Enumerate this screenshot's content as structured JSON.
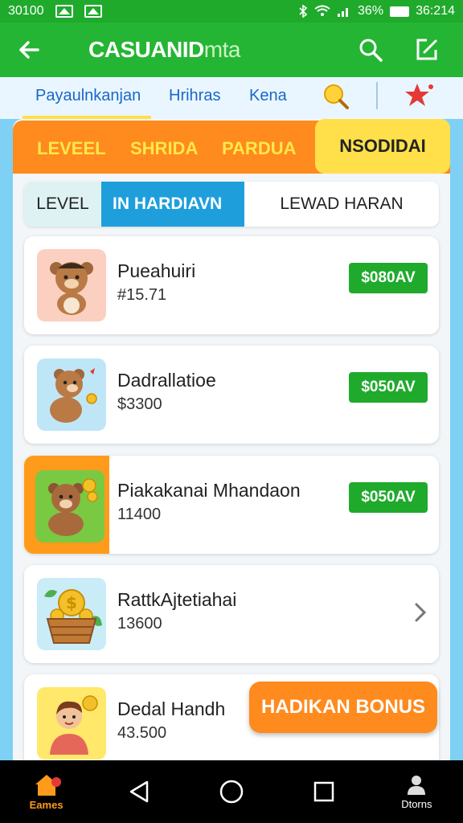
{
  "status_bar": {
    "time_left": "30100",
    "battery": "36%",
    "time_right": "36:214"
  },
  "app_bar": {
    "title_bold": "CASUANID",
    "title_light": "mta"
  },
  "sub_nav": {
    "items": [
      "Payaulnkanjan",
      "Hrihras",
      "Kena"
    ]
  },
  "categories": {
    "items": [
      "LEVEEL",
      "SHRIDA",
      "PARDUA"
    ],
    "active": "NSODIDAI"
  },
  "segments": {
    "items": [
      "LEVEL",
      "IN HARDIAVN",
      "LEWAD HARAN"
    ]
  },
  "cards": [
    {
      "name": "Pueahuiri",
      "amount": "#15.71",
      "action": "$080AV"
    },
    {
      "name": "Dadrallatioe",
      "amount": "$3300",
      "action": "$050AV"
    },
    {
      "name": "Piakakanai Mhandaon",
      "amount": "11400",
      "action": "$050AV"
    },
    {
      "name": "RattkAjtetiahai",
      "amount": "13600"
    },
    {
      "name": "Dedal Handh",
      "amount": "43.500"
    }
  ],
  "bonus_button": {
    "label": "HADIKAN BONUS"
  },
  "nav": {
    "home_label": "Eames",
    "profile_label": "Dtorns"
  },
  "colors": {
    "primary_green": "#25b534",
    "accent_orange": "#ff8a1e",
    "accent_yellow": "#ffe04a",
    "accent_blue": "#1e9fdc"
  }
}
